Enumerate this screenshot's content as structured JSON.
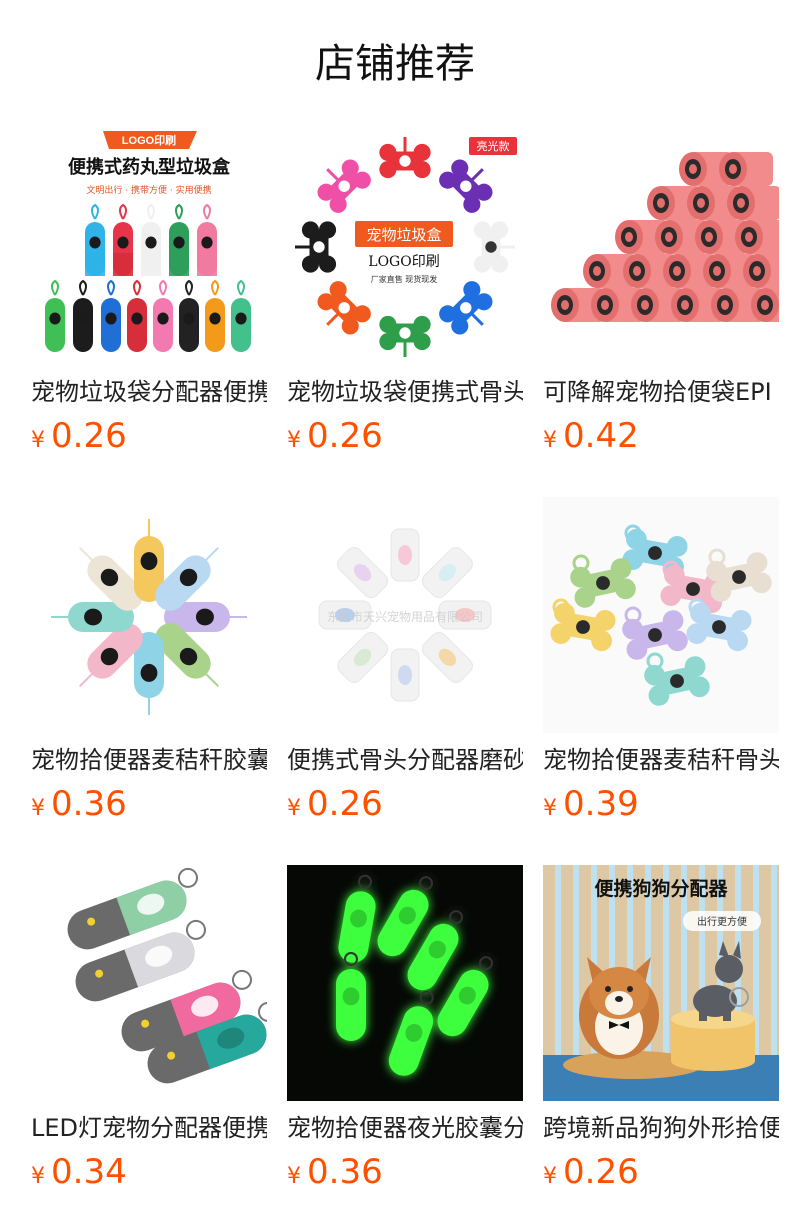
{
  "shop": {
    "title": "店铺推荐"
  },
  "products": [
    {
      "name": "宠物垃圾袋分配器便携式药丸型垃圾盒",
      "currency": "¥",
      "price": "0.26",
      "image": {
        "badge": "LOGO印刷",
        "headline": "便携式药丸型垃圾盒",
        "tagline": "文明出行 · 携带方便 · 实用便携",
        "colors": [
          "#2fb3e8",
          "#e8344a",
          "#f0f0f0",
          "#2e9e5b",
          "#f07aa0",
          "#3fbf55",
          "#1c1c1c",
          "#1f6fd6",
          "#d62e3a",
          "#f27ab0",
          "#222222",
          "#f39a1b",
          "#43c08b"
        ]
      }
    },
    {
      "name": "宠物垃圾袋便携式骨头分配器",
      "currency": "¥",
      "price": "0.26",
      "image": {
        "badge": "亮光款",
        "center_label": "宠物垃圾盒",
        "center_sub": "LOGO印刷",
        "center_note": "厂家直售 现货现发",
        "colors": [
          "#e8333b",
          "#6b2fb3",
          "#f0f0f0",
          "#1f6fe0",
          "#2e9e4b",
          "#f05a1e",
          "#1c1c1c",
          "#f04fa8"
        ]
      }
    },
    {
      "name": "可降解宠物拾便袋EPI",
      "currency": "¥",
      "price": "0.42",
      "image": {
        "colors": [
          "#f28b8b",
          "#e36e6e",
          "#2b2b2b"
        ]
      }
    },
    {
      "name": "宠物拾便器麦秸秆胶囊分配器",
      "currency": "¥",
      "price": "0.36",
      "image": {
        "colors": [
          "#c9b6ea",
          "#a9d28a",
          "#8fd3e6",
          "#f2b7c8",
          "#8ed8cf",
          "#ece4d4",
          "#f4c85c",
          "#b9d8f2"
        ]
      }
    },
    {
      "name": "便携式骨头分配器磨砂",
      "currency": "¥",
      "price": "0.26",
      "image": {
        "watermark": "东莞市天兴宠物用品有限公司",
        "colors": [
          "#f6c7c7",
          "#f3d9a8",
          "#cfd9ef",
          "#d9e9d2",
          "#b9cfee",
          "#e7d2f0",
          "#f5c9d8",
          "#d7eef5"
        ]
      }
    },
    {
      "name": "宠物拾便器麦秸秆骨头分配器",
      "currency": "¥",
      "price": "0.39",
      "image": {
        "colors": [
          "#8fd3e6",
          "#a9d28a",
          "#f2b7c8",
          "#e8dfd2",
          "#f4d36a",
          "#c9b6ea",
          "#b9d8f2",
          "#8ed8cf"
        ]
      }
    },
    {
      "name": "LED灯宠物分配器便携式",
      "currency": "¥",
      "price": "0.34",
      "image": {
        "colors": [
          "#8fcfa6",
          "#d9d9de",
          "#f06aa0",
          "#27a89c",
          "#6a6a6a",
          "#f2d12e"
        ]
      }
    },
    {
      "name": "宠物拾便器夜光胶囊分配器",
      "currency": "¥",
      "price": "0.36",
      "image": {
        "colors": [
          "#3cff3c",
          "#0a1a0a"
        ]
      }
    },
    {
      "name": "跨境新品狗狗外形拾便器",
      "currency": "¥",
      "price": "0.26",
      "image": {
        "headline": "便携狗狗分配器",
        "tagline": "出行更方便",
        "colors": [
          "#bfe0ee",
          "#e8c08b",
          "#c97a3a",
          "#5a5d63",
          "#f1c46a"
        ]
      }
    }
  ]
}
